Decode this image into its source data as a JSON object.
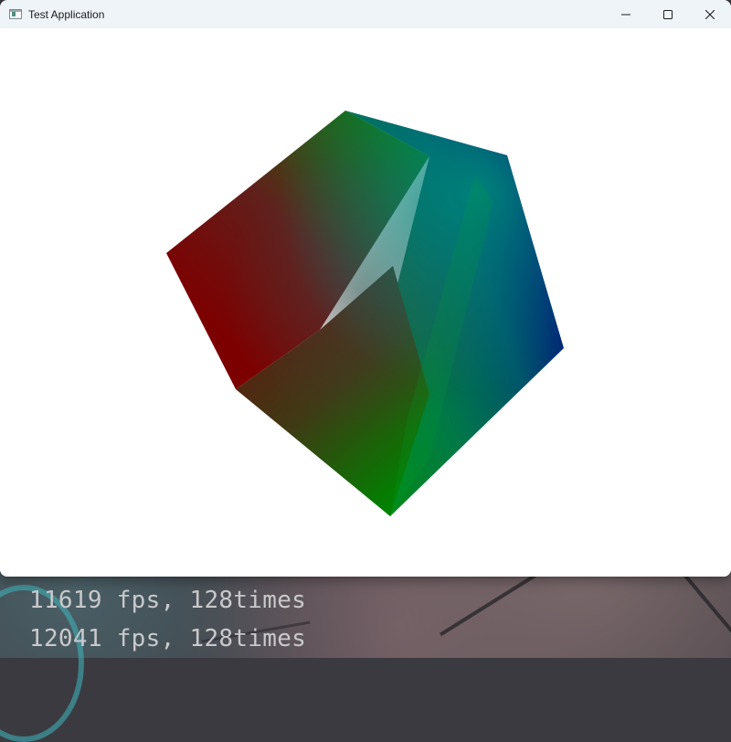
{
  "window": {
    "title": "Test Application",
    "icon": "app-window-icon",
    "caption_buttons": [
      {
        "name": "minimize-icon"
      },
      {
        "name": "maximize-icon"
      },
      {
        "name": "close-icon"
      }
    ]
  },
  "scene": {
    "background_color": "#ffffff",
    "object": "rotating-cube",
    "vertex_colors": {
      "red": "#7d0000",
      "green": "#008000",
      "blue": "#000080",
      "teal": "#008070"
    }
  },
  "console": {
    "lines": [
      "11619 fps, 128times",
      "12041 fps, 128times"
    ]
  }
}
